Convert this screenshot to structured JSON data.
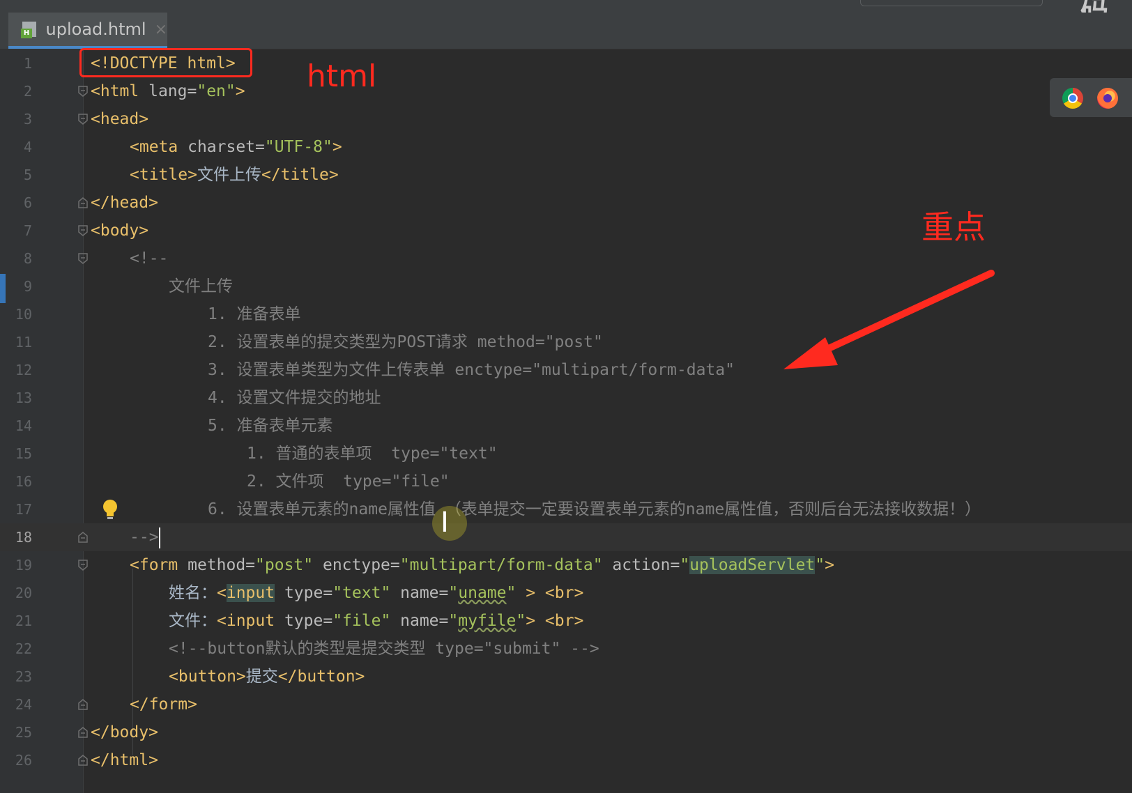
{
  "window": {
    "watermark": "码"
  },
  "tab": {
    "label": "upload.html",
    "close": "×",
    "file_badge": "H"
  },
  "annotations": {
    "html_label": "html",
    "key_point_label": "重点"
  },
  "cursor": {
    "ibeam": "I"
  },
  "editor": {
    "current_line": 18,
    "lines": [
      {
        "n": "1",
        "t": [
          "<!DOCTYPE html>"
        ]
      },
      {
        "n": "2",
        "t": [
          "<html",
          " lang=",
          "\"en\"",
          ">"
        ]
      },
      {
        "n": "3",
        "t": [
          "<head>"
        ]
      },
      {
        "n": "4",
        "t": [
          "<meta",
          " charset=",
          "\"UTF-8\"",
          ">"
        ]
      },
      {
        "n": "5",
        "t": [
          "<title>",
          "文件上传",
          "</title>"
        ]
      },
      {
        "n": "6",
        "t": [
          "</head>"
        ]
      },
      {
        "n": "7",
        "t": [
          "<body>"
        ]
      },
      {
        "n": "8",
        "t": [
          "<!--"
        ]
      },
      {
        "n": "9",
        "t": [
          "文件上传"
        ]
      },
      {
        "n": "10",
        "t": [
          "1. 准备表单"
        ]
      },
      {
        "n": "11",
        "t": [
          "2. 设置表单的提交类型为POST请求 method=\"post\""
        ]
      },
      {
        "n": "12",
        "t": [
          "3. 设置表单类型为文件上传表单 enctype=\"multipart/form-data\""
        ]
      },
      {
        "n": "13",
        "t": [
          "4. 设置文件提交的地址"
        ]
      },
      {
        "n": "14",
        "t": [
          "5. 准备表单元素"
        ]
      },
      {
        "n": "15",
        "t": [
          "1. 普通的表单项  type=\"text\""
        ]
      },
      {
        "n": "16",
        "t": [
          "2. 文件项  type=\"file\""
        ]
      },
      {
        "n": "17",
        "t": [
          "6. 设置表单元素的name属性值 （表单提交一定要设置表单元素的name属性值，否则后台无法接收数据！）"
        ]
      },
      {
        "n": "18",
        "t": [
          "-->"
        ]
      },
      {
        "n": "19",
        "t": [
          "<form",
          " method=",
          "\"post\"",
          " enctype=",
          "\"multipart/form-data\"",
          " action=",
          "\"",
          "uploadServlet",
          "\"",
          ">"
        ]
      },
      {
        "n": "20",
        "t": [
          "姓名：",
          "<",
          "input",
          " type=",
          "\"text\"",
          " name=",
          "\"",
          "uname",
          "\"",
          " > ",
          "<br>"
        ]
      },
      {
        "n": "21",
        "t": [
          "文件：",
          "<",
          "input",
          " type=",
          "\"file\"",
          " name=",
          "\"",
          "myfile",
          "\"",
          "> ",
          "<br>"
        ]
      },
      {
        "n": "22",
        "t": [
          "<!--button默认的类型是提交类型 type=\"submit\" -->"
        ]
      },
      {
        "n": "23",
        "t": [
          "<button>",
          "提交",
          "</button>"
        ]
      },
      {
        "n": "24",
        "t": [
          "</form>"
        ]
      },
      {
        "n": "25",
        "t": [
          "</body>"
        ]
      },
      {
        "n": "26",
        "t": [
          "</html>"
        ]
      }
    ]
  },
  "colors": {
    "annotation_red": "#ff2a1f",
    "tag": "#e8bf6a",
    "string": "#a5c25c",
    "comment": "#808080",
    "background": "#2b2b2b"
  }
}
